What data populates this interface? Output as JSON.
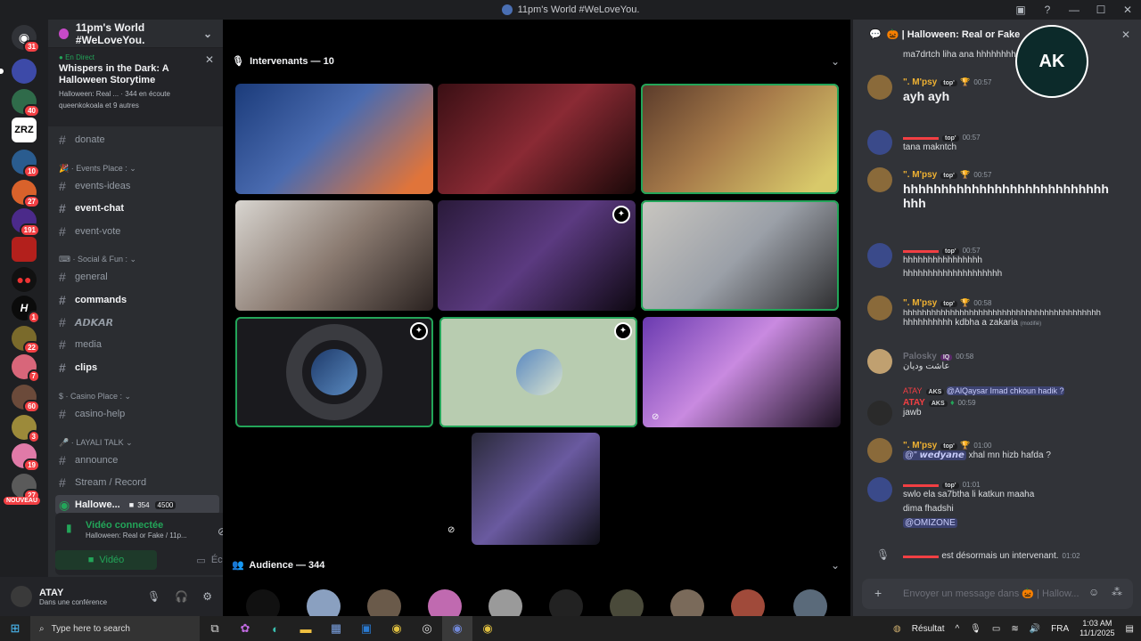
{
  "window": {
    "title": "11pm's World #WeLoveYou."
  },
  "server": {
    "name": "11pm's World #WeLoveYou."
  },
  "live_event": {
    "status": "En Direct",
    "title": "Whispers in the Dark: A Halloween Storytime",
    "meta": "Halloween: Real ... · 344 en écoute",
    "hosts": "queenkokoala et 9 autres"
  },
  "channels": {
    "donate": "donate",
    "cat_events": "Events Place :",
    "events_ideas": "events-ideas",
    "event_chat": "event-chat",
    "event_vote": "event-vote",
    "cat_social": "Social & Fun :",
    "general": "general",
    "commands": "commands",
    "adkar": "𝘼𝘿𝙆𝘼𝙍",
    "media": "media",
    "clips": "clips",
    "cat_casino": "Casino Place :",
    "casino_help": "casino-help",
    "cat_layali": "LAYALI TALK",
    "announce": "announce",
    "stream_record": "Stream / Record",
    "halloween_voice": "Hallowe...",
    "voice_count_a": "354",
    "voice_count_b": "4500"
  },
  "voice": {
    "status": "Vidéo connectée",
    "sub": "Halloween: Real or Fake / 11p...",
    "video_btn": "Vidéo",
    "screen_btn": "Écran"
  },
  "user": {
    "name": "ATAY",
    "status": "Dans une conférence"
  },
  "guild_badges": [
    "31",
    "40",
    "10",
    "27",
    "191",
    "1",
    "22",
    "7",
    "60",
    "3",
    "19",
    "27"
  ],
  "guild_new": "NOUVEAU",
  "stage": {
    "speakers_header": "Intervenants — 10",
    "audience_header": "Audience — 344"
  },
  "chat": {
    "header": "Halloween: Real or Fake",
    "messages": [
      {
        "text": "ma7drtch liha ana hhhhhhhh"
      },
      {
        "name": "\". M'psy",
        "tag": "top'",
        "time": "00:57",
        "text": "ayh ayh"
      },
      {
        "tag": "top'",
        "time": "00:57",
        "text": "tana makntch"
      },
      {
        "name": "\". M'psy",
        "tag": "top'",
        "time": "00:57",
        "text": "hhhhhhhhhhhhhhhhhhhhhhhhhhh",
        "text2": "hhh"
      },
      {
        "tag": "top'",
        "time": "00:57",
        "text": "hhhhhhhhhhhhhhhh",
        "text2": "hhhhhhhhhhhhhhhhhhhh"
      },
      {
        "name": "\". M'psy",
        "tag": "top'",
        "time": "00:58",
        "text": "hhhhhhhhhhhhhhhhhhhhhhhhhhhhhhhhhhhhhhhhhh",
        "text2": "hhhhhhhhhh kdbha a zakaria",
        "edited": "(modifié)"
      },
      {
        "name": "Palosky",
        "tag": "IQ",
        "time": "00:58",
        "text": "عاشت وديان"
      },
      {
        "reply": "@AlQaysar Imad chkoun hadik ?",
        "reply_tag": "AKS",
        "name": "ATAY",
        "tag": "AKS",
        "time": "00:59",
        "text": "jawb"
      },
      {
        "name": "\". M'psy",
        "tag": "top'",
        "time": "01:00",
        "mention": "@\" 𝙬𝙚𝙙𝙮𝙖𝙣𝙚",
        "text": "xhal mn hizb hafda ?"
      },
      {
        "tag": "top'",
        "time": "01:01",
        "text": "swlo ela sa7btha li katkun maaha",
        "text2": "dima fhadshi",
        "mention": "@OMIZONE"
      },
      {
        "text": "est désormais un intervenant.",
        "time": "01:02"
      }
    ],
    "composer_placeholder": "Envoyer un message dans 🎃 | Hallow..."
  },
  "taskbar": {
    "search": "Type here to search",
    "weather": "Résultat",
    "lang": "FRA",
    "time": "1:03 AM",
    "date": "11/1/2025"
  },
  "colors": {
    "accent": "#5865f2",
    "speaking": "#23a559",
    "live": "#23a559",
    "badge": "#f23f43"
  }
}
